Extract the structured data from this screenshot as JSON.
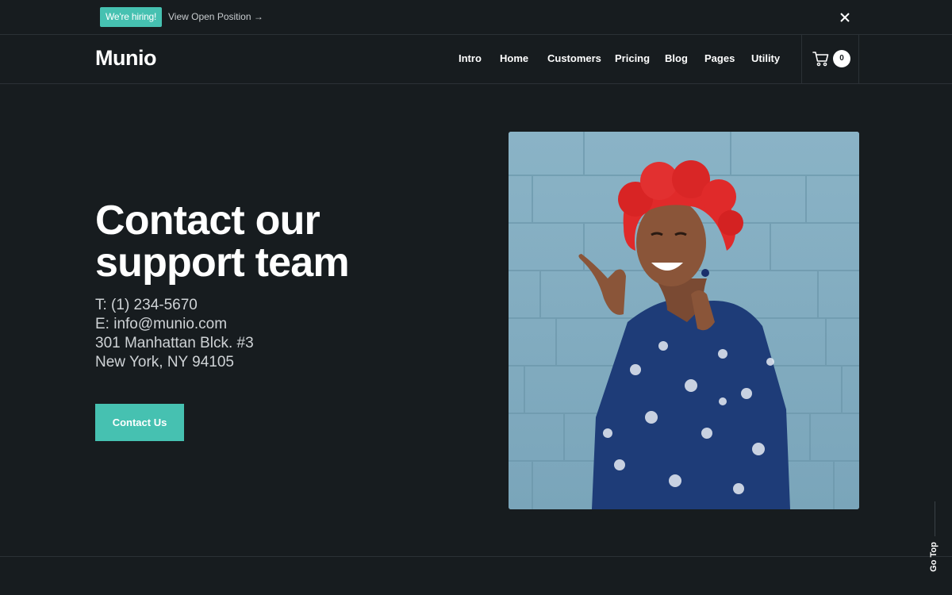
{
  "topbar": {
    "badge": "We're hiring!",
    "link": "View Open Position →",
    "close_icon": "close-icon"
  },
  "header": {
    "logo": "Munio",
    "nav": [
      "Intro",
      "Home",
      "Customers",
      "Pricing",
      "Blog",
      "Pages",
      "Utility"
    ],
    "cart_icon": "cart-icon",
    "cart_count": "0"
  },
  "hero": {
    "title_line1": "Contact our",
    "title_line2": "support team",
    "phone": "T: (1) 234-5670",
    "email": "E: info@munio.com",
    "address1": "301 Manhattan Blck. #3",
    "address2": "New York, NY 94105",
    "button": "Contact Us"
  },
  "go_top": "Go Top",
  "colors": {
    "background": "#171c1f",
    "accent": "#46c1b1",
    "divider": "#2b3136"
  }
}
